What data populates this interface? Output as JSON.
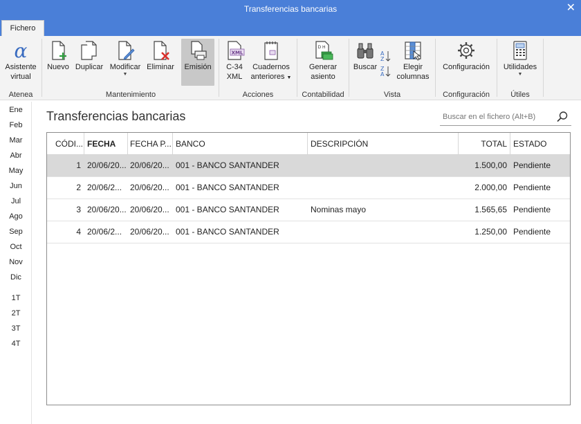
{
  "window": {
    "title": "Transferencias bancarias"
  },
  "tabs": {
    "file": "Fichero"
  },
  "ribbon": {
    "groups": {
      "atenea": "Atenea",
      "mantenimiento": "Mantenimiento",
      "acciones": "Acciones",
      "contabilidad": "Contabilidad",
      "vista": "Vista",
      "configuracion": "Configuración",
      "utiles": "Útiles"
    },
    "buttons": {
      "asistente_1": "Asistente",
      "asistente_2": "virtual",
      "nuevo": "Nuevo",
      "duplicar": "Duplicar",
      "modificar": "Modificar",
      "eliminar": "Eliminar",
      "emision": "Emisión",
      "c34_1": "C-34",
      "c34_2": "XML",
      "cuadernos_1": "Cuadernos",
      "cuadernos_2": "anteriores",
      "generar_1": "Generar",
      "generar_2": "asiento",
      "buscar": "Buscar",
      "elegir_1": "Elegir",
      "elegir_2": "columnas",
      "configuracion": "Configuración",
      "utilidades": "Utilidades",
      "xml_icon_text": "XML",
      "dh_icon_text": "D H"
    }
  },
  "months": [
    "Ene",
    "Feb",
    "Mar",
    "Abr",
    "May",
    "Jun",
    "Jul",
    "Ago",
    "Sep",
    "Oct",
    "Nov",
    "Dic",
    "1T",
    "2T",
    "3T",
    "4T"
  ],
  "main": {
    "title": "Transferencias bancarias",
    "search_placeholder": "Buscar en el fichero (Alt+B)"
  },
  "table": {
    "columns": [
      "CÓDI...",
      "FECHA",
      "FECHA P...",
      "BANCO",
      "DESCRIPCIÓN",
      "TOTAL",
      "ESTADO"
    ],
    "rows": [
      {
        "codigo": "1",
        "fecha": "20/06/20...",
        "fecha_p": "20/06/20...",
        "banco": "001 - BANCO SANTANDER",
        "descripcion": "",
        "total": "1.500,00",
        "estado": "Pendiente",
        "selected": true
      },
      {
        "codigo": "2",
        "fecha": "20/06/2...",
        "fecha_p": "20/06/20...",
        "banco": "001 - BANCO SANTANDER",
        "descripcion": "",
        "total": "2.000,00",
        "estado": "Pendiente",
        "selected": false
      },
      {
        "codigo": "3",
        "fecha": "20/06/20...",
        "fecha_p": "20/06/20...",
        "banco": "001 - BANCO SANTANDER",
        "descripcion": "Nominas mayo",
        "total": "1.565,65",
        "estado": "Pendiente",
        "selected": false
      },
      {
        "codigo": "4",
        "fecha": "20/06/2...",
        "fecha_p": "20/06/20...",
        "banco": "001 - BANCO SANTANDER",
        "descripcion": "",
        "total": "1.250,00",
        "estado": "Pendiente",
        "selected": false
      }
    ]
  },
  "colors": {
    "titlebar": "#4a7fd8",
    "ribbon_bg": "#f3f3f3",
    "selected_row": "#d9d9d9",
    "accent_green": "#2e9e3e",
    "accent_red": "#d9302c"
  }
}
